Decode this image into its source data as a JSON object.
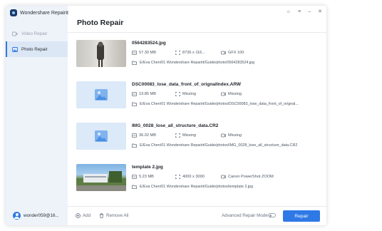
{
  "app": {
    "name": "Wondershare Repairit"
  },
  "window_controls": [
    "headset-icon",
    "menu-icon",
    "minimize-icon",
    "close-icon"
  ],
  "sidebar": {
    "items": [
      {
        "label": "Video Repair",
        "icon": "video-icon",
        "active": false
      },
      {
        "label": "Photo Repair",
        "icon": "photo-icon",
        "active": true
      }
    ],
    "user": "wonder059@16..."
  },
  "main": {
    "title": "Photo Repair",
    "files": [
      {
        "name": "0564283524.jpg",
        "size": "57.30  MB",
        "resolution": "8736 x 116...",
        "device": "GFX 100",
        "path": "E/Eva Chen/01 Wondershare Repairit/Guide/photo/0564283524.jpg",
        "thumb": "photo"
      },
      {
        "name": "DSC00083_lose_data_front_of_orignalIndex.ARW",
        "size": "19.85  MB",
        "resolution": "Missing",
        "device": "Missing",
        "path": "E/Eva Chen/01 Wondershare Repairit/Guide/photos/DSC00083_lose_data_front_of_orignal...",
        "thumb": "placeholder"
      },
      {
        "name": "IMG_0028_lose_all_structure_data.CR2",
        "size": "36.02  MB",
        "resolution": "Missing",
        "device": "Missing",
        "path": "E/Eva Chen/01 Wondershare Repairit/Guide/photos/IMG_0028_lose_all_structure_data.CR2",
        "thumb": "placeholder"
      },
      {
        "name": "template 2.jpg",
        "size": "5.23  MB",
        "resolution": "4000 x 3000",
        "device": "Canon PowerShot ZOOM",
        "path": "E/Eva Chen/01 Wondershare Repairit/Guide/photos/template 2.jpg",
        "thumb": "photo"
      }
    ]
  },
  "footer": {
    "add_label": "Add",
    "remove_label": "Remove All",
    "advanced_label": "Advanced Repair Mode",
    "advanced_on": false,
    "repair_label": "Repair"
  },
  "colors": {
    "accent": "#2f79e6",
    "sidebar_bg": "#eef3fa"
  }
}
